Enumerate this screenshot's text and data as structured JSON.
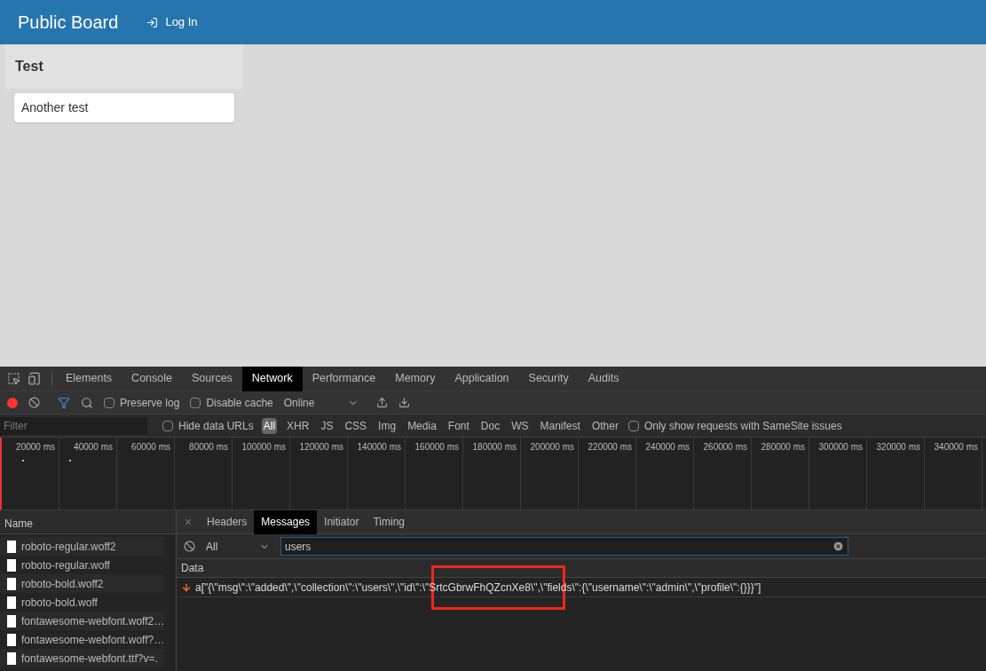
{
  "app_header": {
    "title": "Public Board",
    "login_link": "Log In"
  },
  "board": {
    "list_title": "Test",
    "cards": [
      {
        "text": "Another test"
      }
    ]
  },
  "devtools": {
    "tabs": [
      {
        "label": "Elements",
        "selected": false
      },
      {
        "label": "Console",
        "selected": false
      },
      {
        "label": "Sources",
        "selected": false
      },
      {
        "label": "Network",
        "selected": true
      },
      {
        "label": "Performance",
        "selected": false
      },
      {
        "label": "Memory",
        "selected": false
      },
      {
        "label": "Application",
        "selected": false
      },
      {
        "label": "Security",
        "selected": false
      },
      {
        "label": "Audits",
        "selected": false
      }
    ],
    "toolbar": {
      "recording": true,
      "preserve_log": {
        "label": "Preserve log",
        "checked": false
      },
      "disable_cache": {
        "label": "Disable cache",
        "checked": false
      },
      "throttling": "Online"
    },
    "filter_bar": {
      "placeholder": "Filter",
      "hide_data_urls": {
        "label": "Hide data URLs",
        "checked": false
      },
      "types": [
        {
          "label": "All",
          "selected": true
        },
        {
          "label": "XHR",
          "selected": false
        },
        {
          "label": "JS",
          "selected": false
        },
        {
          "label": "CSS",
          "selected": false
        },
        {
          "label": "Img",
          "selected": false
        },
        {
          "label": "Media",
          "selected": false
        },
        {
          "label": "Font",
          "selected": false
        },
        {
          "label": "Doc",
          "selected": false
        },
        {
          "label": "WS",
          "selected": false
        },
        {
          "label": "Manifest",
          "selected": false
        },
        {
          "label": "Other",
          "selected": false
        }
      ],
      "samesite": {
        "label": "Only show requests with SameSite issues",
        "checked": false
      }
    },
    "timeline_ticks": [
      "20000 ms",
      "40000 ms",
      "60000 ms",
      "80000 ms",
      "100000 ms",
      "120000 ms",
      "140000 ms",
      "160000 ms",
      "180000 ms",
      "200000 ms",
      "220000 ms",
      "240000 ms",
      "260000 ms",
      "280000 ms",
      "300000 ms",
      "320000 ms",
      "340000 ms"
    ],
    "requests": {
      "column": "Name",
      "rows": [
        {
          "name": "roboto-regular.woff2"
        },
        {
          "name": "roboto-regular.woff"
        },
        {
          "name": "roboto-bold.woff2"
        },
        {
          "name": "roboto-bold.woff"
        },
        {
          "name": "fontawesome-webfont.woff2…"
        },
        {
          "name": "fontawesome-webfont.woff?…"
        },
        {
          "name": "fontawesome-webfont.ttf?v=."
        }
      ]
    },
    "detail": {
      "close": "×",
      "tabs": [
        {
          "label": "Headers",
          "selected": false
        },
        {
          "label": "Messages",
          "selected": true
        },
        {
          "label": "Initiator",
          "selected": false
        },
        {
          "label": "Timing",
          "selected": false
        }
      ],
      "message_filter": {
        "type": "All",
        "value": "users"
      },
      "column": "Data",
      "messages": [
        {
          "kind": "received",
          "data": "a[\"{\\\"msg\\\":\\\"added\\\",\\\"collection\\\":\\\"users\\\",\\\"id\\\":\\\"SrtcGbrwFhQZcnXe8\\\",\\\"fields\\\":{\\\"username\\\":\\\"admin\\\",\\\"profile\\\":{}}}\"]"
        }
      ],
      "highlight_box": true
    }
  }
}
